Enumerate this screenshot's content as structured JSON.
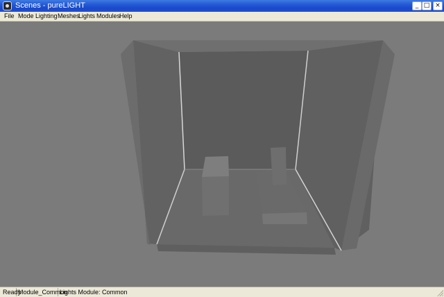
{
  "window": {
    "title": "Scenes - pureLIGHT",
    "controls": {
      "minimize": "_",
      "maximize": "□",
      "close": "×"
    }
  },
  "menu": {
    "items": [
      "File",
      "Mode",
      "Lighting",
      "Meshes",
      "Lights",
      "Modules",
      "Help"
    ]
  },
  "viewport": {
    "background_color": "#7b7b7b",
    "content": "3D room scene"
  },
  "status": {
    "state": "Ready",
    "module": "Module_Common",
    "lights_module": "Lights Module: Common"
  },
  "icons": {
    "app": "app-icon",
    "resize": "resize-grip-icon"
  }
}
